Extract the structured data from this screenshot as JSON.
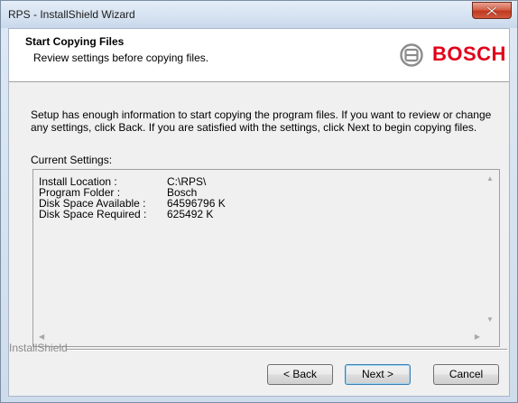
{
  "window": {
    "title": "RPS - InstallShield Wizard"
  },
  "header": {
    "title": "Start Copying Files",
    "subtitle": "Review settings before copying files.",
    "brand": "BOSCH",
    "brand_color": "#e2001a"
  },
  "body": {
    "info": "Setup has enough information to start copying the program files.  If you want to review or change any settings, click Back.  If you are satisfied with the settings, click Next to begin copying files.",
    "settings_label": "Current Settings:",
    "settings": [
      {
        "key": "Install Location :",
        "value": "C:\\RPS\\"
      },
      {
        "key": "Program Folder :",
        "value": "Bosch"
      },
      {
        "key": "Disk Space Available :",
        "value": "64596796 K"
      },
      {
        "key": "Disk Space Required :",
        "value": "625492 K"
      }
    ]
  },
  "footer": {
    "installshield_label": "InstallShield",
    "back_label": "< Back",
    "next_label": "Next >",
    "cancel_label": "Cancel"
  }
}
